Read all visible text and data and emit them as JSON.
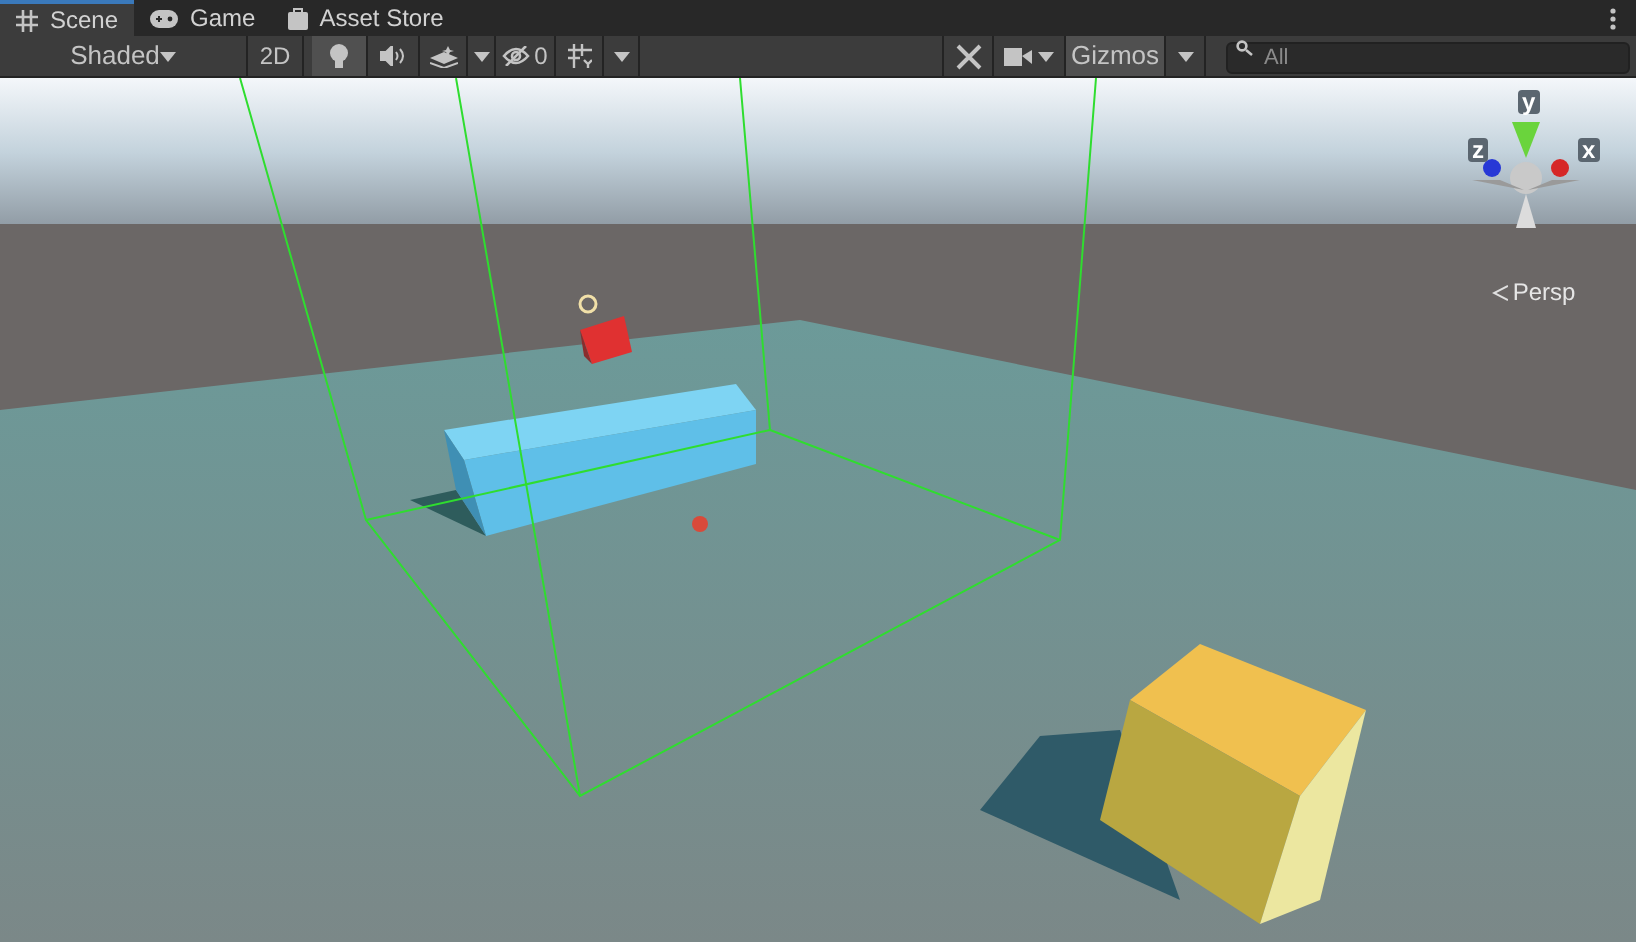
{
  "tabs": [
    {
      "label": "Scene",
      "kind": "grid",
      "selected": true
    },
    {
      "label": "Game",
      "kind": "gamepad",
      "selected": false
    },
    {
      "label": "Asset Store",
      "kind": "bag",
      "selected": false
    }
  ],
  "toolbar": {
    "draw_mode": "Shaded",
    "mode_2d": {
      "label": "2D",
      "on": false
    },
    "lighting_on": true,
    "audio_on": false,
    "hidden_count": "0",
    "gizmos": {
      "label": "Gizmos",
      "on": true
    },
    "search": {
      "placeholder": "All"
    }
  },
  "orientation_gizmo": {
    "axes": [
      "y",
      "z",
      "x"
    ],
    "projection": "Persp"
  }
}
